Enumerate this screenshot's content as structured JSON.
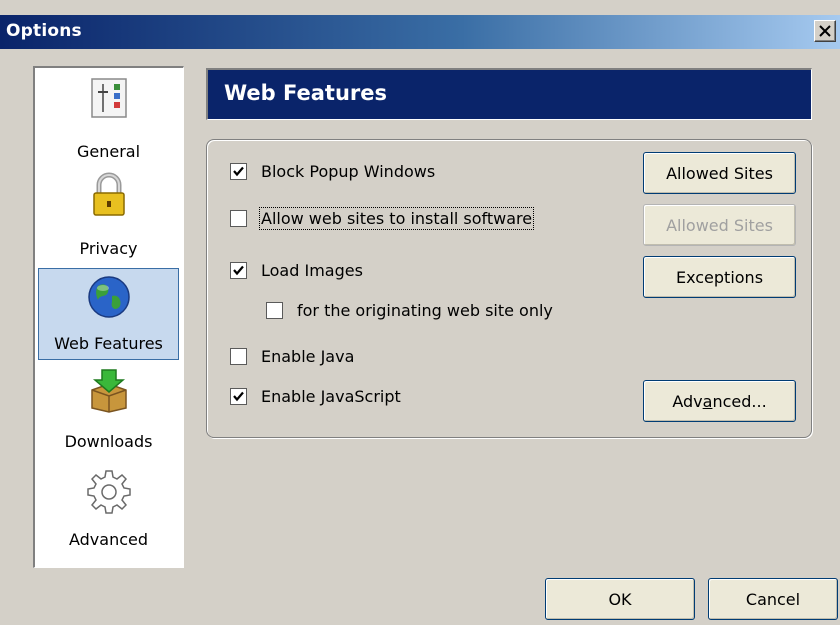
{
  "window": {
    "title": "Options"
  },
  "sidebar": {
    "items": [
      {
        "label": "General",
        "icon": "general-icon",
        "selected": false
      },
      {
        "label": "Privacy",
        "icon": "lock-icon",
        "selected": false
      },
      {
        "label": "Web Features",
        "icon": "globe-icon",
        "selected": true
      },
      {
        "label": "Downloads",
        "icon": "download-box-icon",
        "selected": false
      },
      {
        "label": "Advanced",
        "icon": "gear-icon",
        "selected": false
      }
    ]
  },
  "panel": {
    "title": "Web Features",
    "options": [
      {
        "label": "Block Popup Windows",
        "checked": true
      },
      {
        "label": "Allow web sites to install software",
        "checked": false
      },
      {
        "label": "Load Images",
        "checked": true
      },
      {
        "label": "for the originating web site only",
        "checked": false
      },
      {
        "label": "Enable Java",
        "checked": false
      },
      {
        "label": "Enable JavaScript",
        "checked": true
      }
    ],
    "buttons": {
      "allowed_sites_popup": "Allowed Sites",
      "allowed_sites_install": "Allowed Sites",
      "exceptions": "Exceptions",
      "advanced_pre": "Adv",
      "advanced_accel": "a",
      "advanced_post": "nced..."
    }
  },
  "footer": {
    "ok": "OK",
    "cancel": "Cancel"
  },
  "colors": {
    "titlebar_start": "#0a246a",
    "titlebar_end": "#a6caf0",
    "header_bg": "#0a246a",
    "dialog_bg": "#d4d0c8",
    "selection_bg": "#c7d9ee"
  }
}
